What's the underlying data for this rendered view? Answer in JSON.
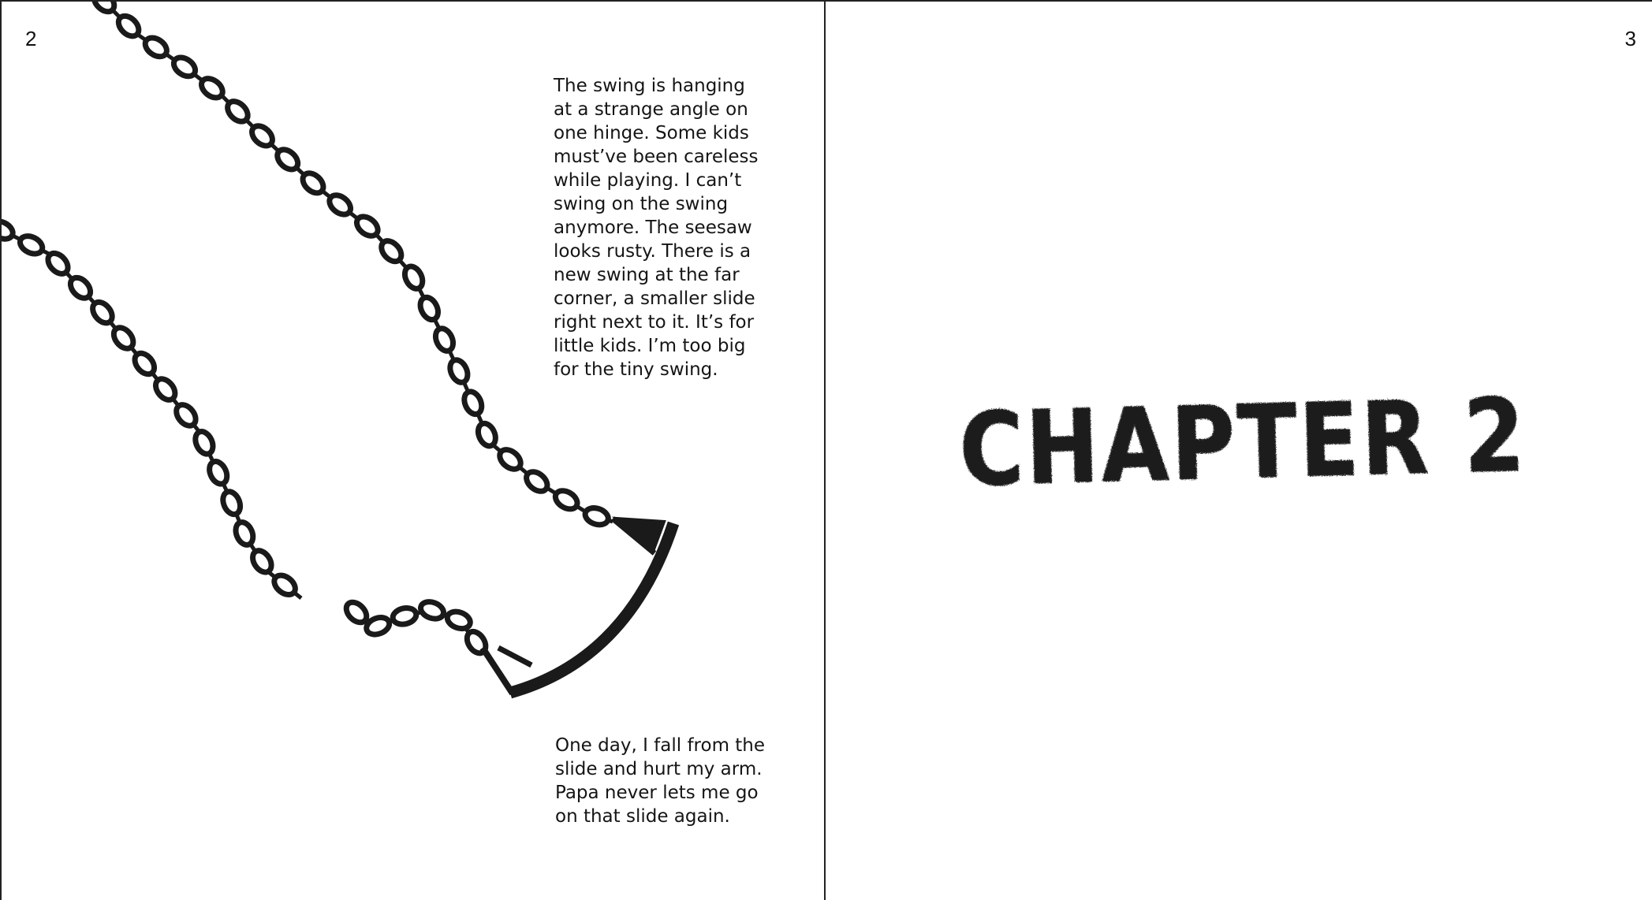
{
  "spread": {
    "left_page": {
      "page_number": "2",
      "text_top": [
        "The swing is hanging",
        "at a strange angle on",
        "one hinge. Some kids",
        "must’ve been careless",
        "while playing. I can’t",
        "swing on the swing",
        "anymore. The seesaw",
        "looks rusty. There is a",
        "new swing at the far",
        "corner, a smaller slide",
        "right next to it. It’s for",
        "little kids. I’m too big",
        "for the tiny swing."
      ],
      "text_bottom": [
        "One day, I fall from the",
        "slide and hurt my arm.",
        "Papa never lets me go",
        " on that slide again."
      ]
    },
    "right_page": {
      "page_number": "3",
      "chapter_title": "CHAPTER 2"
    }
  },
  "colors": {
    "ink": "#1a1a1a",
    "paper": "#ffffff"
  }
}
